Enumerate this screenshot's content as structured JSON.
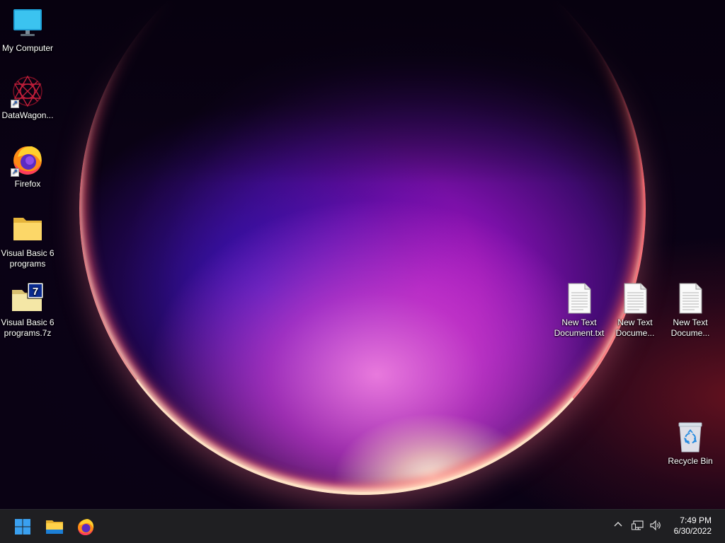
{
  "desktop": {
    "icons": [
      {
        "label": "My Computer",
        "icon": "monitor-icon"
      },
      {
        "label": "DataWagon...",
        "icon": "datawagon-icon",
        "shortcut": true
      },
      {
        "label": "Firefox",
        "icon": "firefox-icon",
        "shortcut": true
      },
      {
        "label": "Visual Basic 6 programs",
        "icon": "folder-icon"
      },
      {
        "label": "Visual Basic 6 programs.7z",
        "icon": "7z-archive-icon"
      },
      {
        "label": "New Text Document.txt",
        "icon": "text-file-icon"
      },
      {
        "label": "New Text Docume...",
        "icon": "text-file-icon"
      },
      {
        "label": "New Text Docume...",
        "icon": "text-file-icon"
      },
      {
        "label": "Recycle Bin",
        "icon": "recycle-bin-icon"
      }
    ]
  },
  "taskbar": {
    "pinned": [
      {
        "name": "Start",
        "icon": "windows-logo-icon"
      },
      {
        "name": "File Explorer",
        "icon": "file-explorer-icon"
      },
      {
        "name": "Firefox",
        "icon": "firefox-icon"
      }
    ],
    "tray": {
      "chevron": "chevron-up-icon",
      "network": "network-icon",
      "volume": "volume-icon"
    },
    "clock": {
      "time": "7:49 PM",
      "date": "6/30/2022"
    }
  },
  "colors": {
    "taskbar_bg": "#1f1f22",
    "accent": "#1e90ff"
  }
}
